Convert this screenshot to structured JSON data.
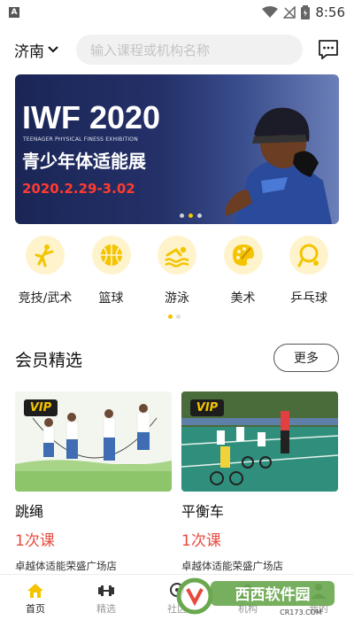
{
  "status_bar": {
    "time": "8:56"
  },
  "header": {
    "city": "济南",
    "search_placeholder": "输入课程或机构名称"
  },
  "banner": {
    "title": "IWF 2020",
    "subtitle": "TEENAGER PHYSICAL FINESS EXHIBITION",
    "headline": "青少年体适能展",
    "date": "2020.2.29-3.02",
    "page_count": 3,
    "active_page": 2
  },
  "categories": [
    {
      "label": "竞技/武术",
      "icon": "martial-arts-icon"
    },
    {
      "label": "篮球",
      "icon": "basketball-icon"
    },
    {
      "label": "游泳",
      "icon": "swimming-icon"
    },
    {
      "label": "美术",
      "icon": "palette-icon"
    },
    {
      "label": "乒乓球",
      "icon": "ping-pong-icon"
    }
  ],
  "category_pages": {
    "count": 2,
    "active": 1
  },
  "section": {
    "title": "会员精选",
    "more_label": "更多"
  },
  "cards": [
    {
      "badge": "VIP",
      "name": "跳绳",
      "price": "1次课",
      "shop": "卓越体适能荣盛广场店"
    },
    {
      "badge": "VIP",
      "name": "平衡车",
      "price": "1次课",
      "shop": "卓越体适能荣盛广场店"
    }
  ],
  "tabs": [
    {
      "label": "首页",
      "icon": "home-icon",
      "active": true
    },
    {
      "label": "精选",
      "icon": "dumbbell-icon",
      "active": false
    },
    {
      "label": "社区",
      "icon": "community-icon",
      "active": false
    },
    {
      "label": "机构",
      "icon": "institution-icon",
      "active": false
    },
    {
      "label": "我的",
      "icon": "profile-icon",
      "active": false
    }
  ],
  "watermark": {
    "text": "西西软件园",
    "url_text": "CR173.COM"
  },
  "colors": {
    "accent": "#f4c400",
    "price": "#e8493c",
    "icon_bg": "#fff3cc"
  }
}
